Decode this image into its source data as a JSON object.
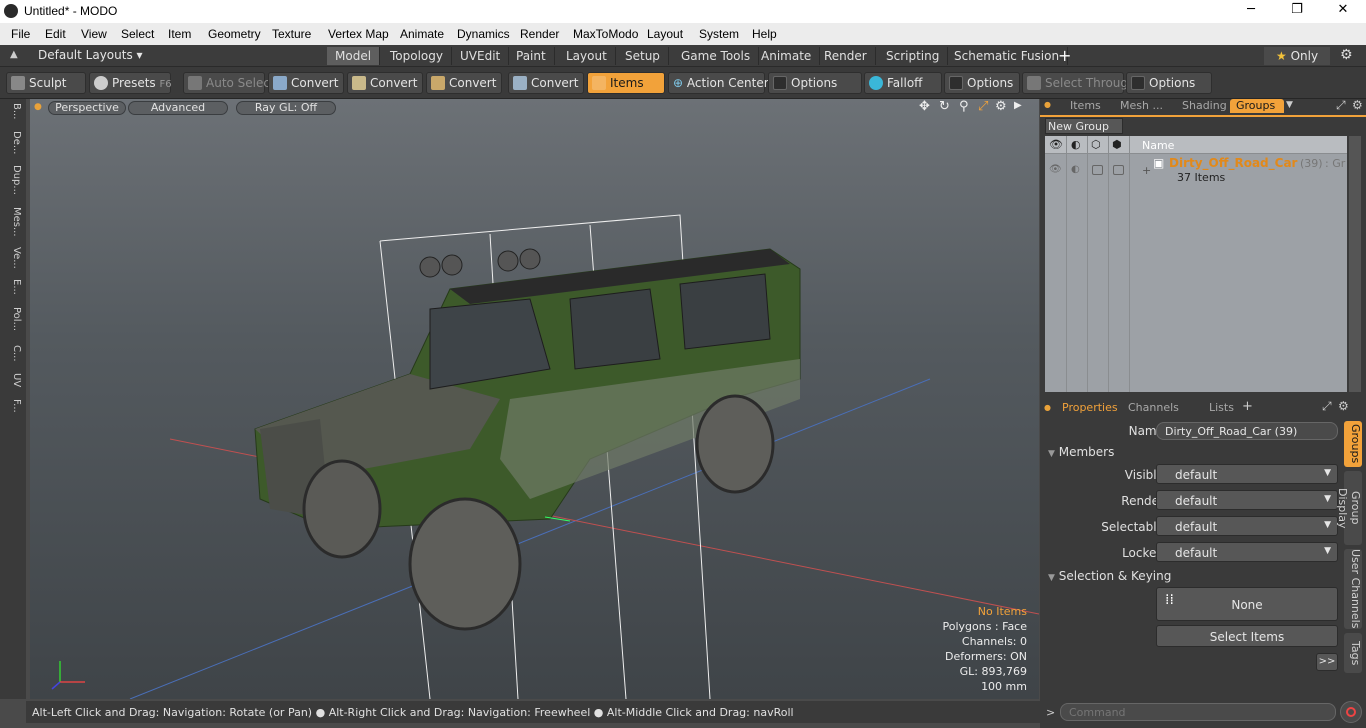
{
  "window": {
    "title": "Untitled* - MODO",
    "minimize": "─",
    "maximize": "❐",
    "close": "✕"
  },
  "menu": [
    "File",
    "Edit",
    "View",
    "Select",
    "Item",
    "Geometry",
    "Texture",
    "Vertex Map",
    "Animate",
    "Dynamics",
    "Render",
    "MaxToModo",
    "Layout",
    "System",
    "Help"
  ],
  "layouts": {
    "preset": "Default Layouts",
    "tabs": [
      "Model",
      "Topology",
      "UVEdit",
      "Paint",
      "Layout",
      "Setup",
      "Game Tools",
      "Animate",
      "Render",
      "Scripting",
      "Schematic Fusion"
    ],
    "active_tab": "Model",
    "add": "+",
    "only": "Only"
  },
  "toolbar": {
    "sculpt": "Sculpt",
    "presets": "Presets",
    "presets_key": "F6",
    "auto_select": "Auto Select",
    "convert1": "Convert",
    "convert2": "Convert",
    "convert3": "Convert",
    "convert4": "Convert",
    "items": "Items",
    "action_center": "Action Center",
    "options1": "Options",
    "falloff": "Falloff",
    "options2": "Options",
    "select_through": "Select Through",
    "options3": "Options"
  },
  "left_tabs": [
    "B...",
    "De...",
    "Dup...",
    "Mes...",
    "Ve...",
    "E...",
    "Pol...",
    "C...",
    "UV",
    "F..."
  ],
  "viewport": {
    "view": "Perspective",
    "shading": "Advanced",
    "raygl": "Ray GL: Off",
    "hud": {
      "items": "No Items",
      "polygons": "Polygons : Face",
      "channels": "Channels: 0",
      "deformers": "Deformers: ON",
      "gl": "GL: 893,769",
      "scale": "100 mm"
    }
  },
  "status": "Alt-Left Click and Drag: Navigation: Rotate (or Pan) ● Alt-Right Click and Drag: Navigation: Freewheel ● Alt-Middle Click and Drag: navRoll",
  "right_panel": {
    "tabs": [
      "Items",
      "Mesh ...",
      "Shading",
      "Groups"
    ],
    "active_tab": "Groups",
    "new_group": "New Group",
    "col_name": "Name",
    "group": {
      "name": "Dirty_Off_Road_Car",
      "count": "(39)",
      "suffix": ": Gr ...",
      "items": "37 Items"
    },
    "props_tabs": [
      "Properties",
      "Channels",
      "Lists"
    ],
    "props_add": "+",
    "name_label": "Name",
    "name_value": "Dirty_Off_Road_Car (39)",
    "members": "Members",
    "visible_label": "Visible",
    "visible": "default",
    "render_label": "Render",
    "render": "default",
    "selectable_label": "Selectable",
    "selectable": "default",
    "locked_label": "Locked",
    "locked": "default",
    "selection_keying": "Selection & Keying",
    "none": "None",
    "select_items": "Select Items",
    "more": ">>",
    "side_tabs": [
      "Groups",
      "Group Display",
      "User Channels",
      "Tags"
    ],
    "command_placeholder": "Command"
  },
  "colors": {
    "accent": "#f2a23a",
    "car_green": "#3d5a2a"
  }
}
